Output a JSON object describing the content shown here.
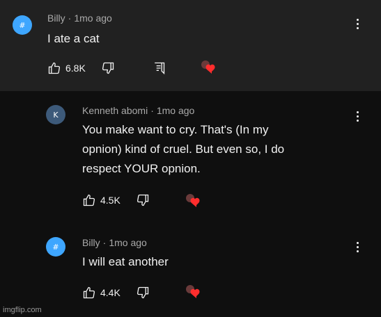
{
  "comments": [
    {
      "author": "Billy",
      "time": "1mo ago",
      "text": "I ate a cat",
      "likes": "6.8K",
      "avatar_text": "#",
      "avatar_color": "#3ea6ff"
    },
    {
      "author": "Kenneth abomi",
      "time": "1mo ago",
      "text_lines": [
        "You make want to cry. That's (In my",
        "opnion) kind of cruel. But even so, I do",
        "respect YOUR opnion."
      ],
      "likes": "4.5K",
      "avatar_text": "K",
      "avatar_color": "#3d5a7a"
    },
    {
      "author": "Billy",
      "time": "1mo ago",
      "text": "I will eat another",
      "likes": "4.4K",
      "avatar_text": "#",
      "avatar_color": "#3ea6ff"
    }
  ],
  "meta_separator": "·",
  "icons": {
    "like": "thumb-up-icon",
    "dislike": "thumb-down-icon",
    "reply": "reply-icon",
    "menu": "more-vert-icon",
    "heart": "creator-heart-icon"
  },
  "watermark": "imgflip.com",
  "colors": {
    "heart": "#ff2d2d",
    "meta": "#aaaaaa"
  }
}
